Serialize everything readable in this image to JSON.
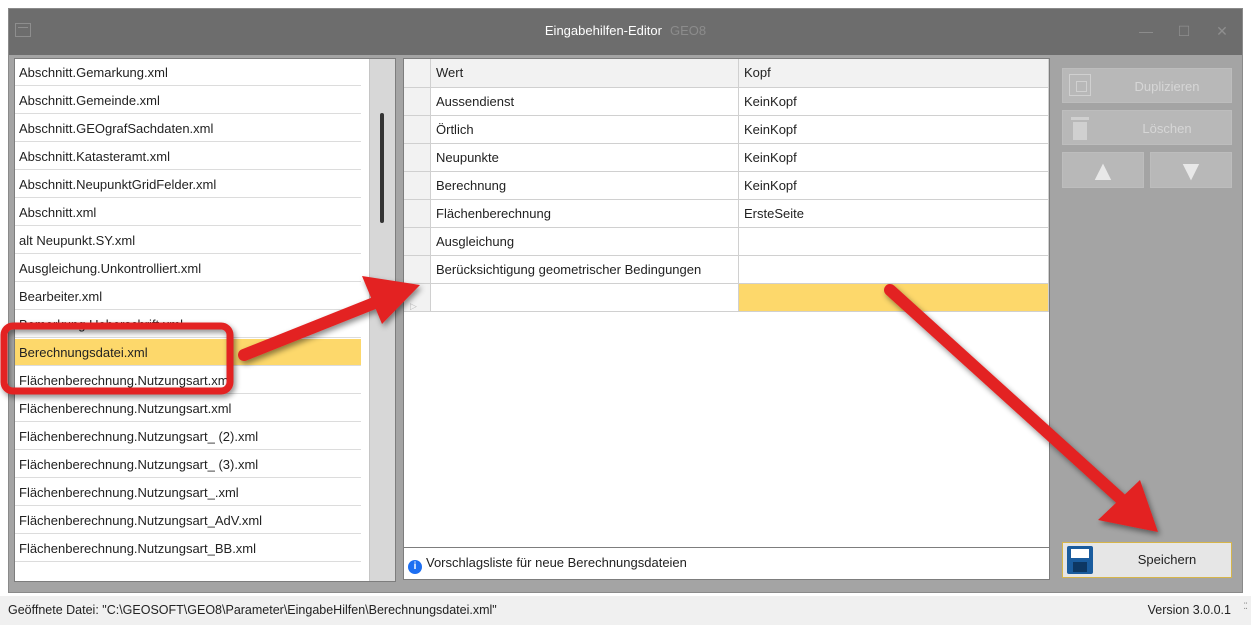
{
  "window": {
    "title": "Eingabehilfen-Editor",
    "subtitle": "GEO8",
    "minimize_glyph": "—",
    "maximize_glyph": "☐",
    "close_glyph": "✕"
  },
  "file_list": {
    "items": [
      "Abschnitt.Gemarkung.xml",
      "Abschnitt.Gemeinde.xml",
      "Abschnitt.GEOgrafSachdaten.xml",
      "Abschnitt.Katasteramt.xml",
      "Abschnitt.NeupunktGridFelder.xml",
      "Abschnitt.xml",
      "alt Neupunkt.SY.xml",
      "Ausgleichung.Unkontrolliert.xml",
      "Bearbeiter.xml",
      "Bemerkung.Ueberschrift.xml",
      "Berechnungsdatei.xml",
      "Flächenberechnung.Nutzungsart.xml",
      "Flächenberechnung.Nutzungsart.xml",
      "Flächenberechnung.Nutzungsart_ (2).xml",
      "Flächenberechnung.Nutzungsart_ (3).xml",
      "Flächenberechnung.Nutzungsart_.xml",
      "Flächenberechnung.Nutzungsart_AdV.xml",
      "Flächenberechnung.Nutzungsart_BB.xml"
    ],
    "selected": "Berechnungsdatei.xml"
  },
  "grid": {
    "columns": [
      "Wert",
      "Kopf"
    ],
    "rows": [
      [
        "Aussendienst",
        "KeinKopf"
      ],
      [
        "Örtlich",
        "KeinKopf"
      ],
      [
        "Neupunkte",
        "KeinKopf"
      ],
      [
        "Berechnung",
        "KeinKopf"
      ],
      [
        "Flächenberechnung",
        "ErsteSeite"
      ],
      [
        "Ausgleichung",
        ""
      ],
      [
        "Berücksichtigung geometrischer Bedingungen",
        ""
      ],
      [
        "",
        ""
      ]
    ],
    "new_row_indicator": "▷",
    "footer_icon": "info-icon",
    "footer": "Vorschlagsliste für neue Berechnungsdateien"
  },
  "actions": {
    "duplicate": "Duplizieren",
    "delete": "Löschen",
    "up_glyph": "▲",
    "down_glyph": "▼",
    "save": "Speichern"
  },
  "status": {
    "file": "Geöffnete Datei: \"C:\\GEOSOFT\\GEO8\\Parameter\\EingabeHilfen\\Berechnungsdatei.xml\"",
    "version": "Version 3.0.0.1"
  },
  "colors": {
    "selection": "#fdd86b",
    "annotation": "#e32222",
    "titlebar": "#6d6d6d"
  }
}
